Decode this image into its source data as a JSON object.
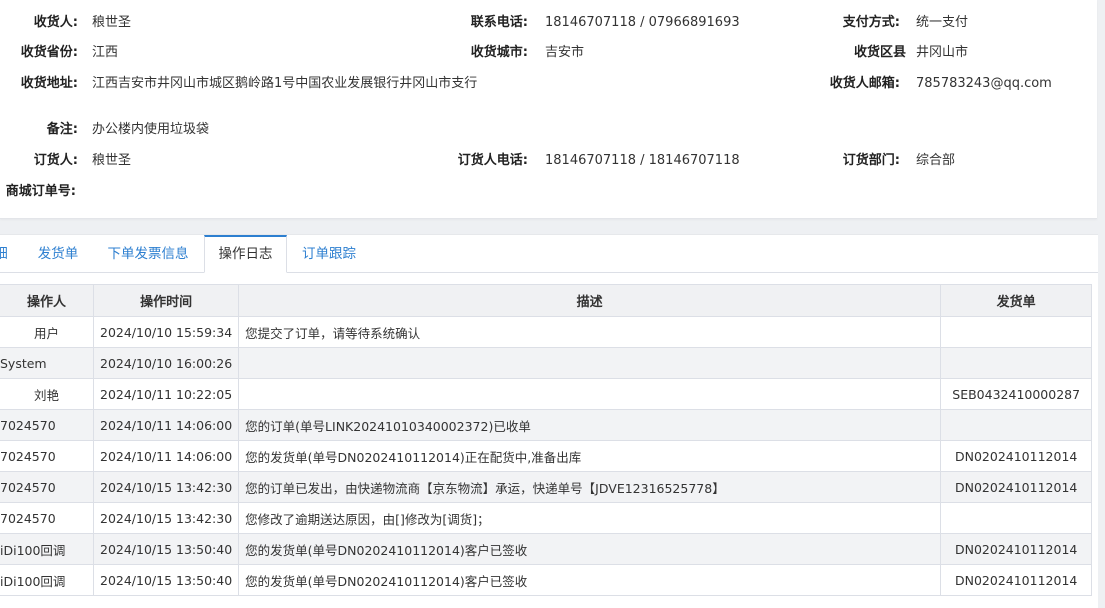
{
  "receiver": {
    "name_label": "收货人:",
    "name": "稂世圣",
    "phone_label": "联系电话:",
    "phone": "18146707118 / 07966891693",
    "pay_label": "支付方式:",
    "pay": "统一支付",
    "province_label": "收货省份:",
    "province": "江西",
    "city_label": "收货城市:",
    "city": "吉安市",
    "district_label": "收货区县",
    "district": "井冈山市",
    "address_label": "收货地址:",
    "address": "江西吉安市井冈山市城区鹅岭路1号中国农业发展银行井冈山市支行",
    "email_label": "收货人邮箱:",
    "email": "785783243@qq.com",
    "remark_label": "备注:",
    "remark": "办公楼内使用垃圾袋",
    "orderer_label": "订货人:",
    "orderer": "稂世圣",
    "orderer_phone_label": "订货人电话:",
    "orderer_phone": "18146707118 / 18146707118",
    "dept_label": "订货部门:",
    "dept": "综合部",
    "mall_order_label": "商城订单号:",
    "mall_order": ""
  },
  "tabs": [
    {
      "label": "细"
    },
    {
      "label": "发货单"
    },
    {
      "label": "下单发票信息"
    },
    {
      "label": "操作日志"
    },
    {
      "label": "订单跟踪"
    }
  ],
  "active_tab": "操作日志",
  "log_table": {
    "headers": [
      "操作人",
      "操作时间",
      "描述",
      "发货单"
    ],
    "rows": [
      {
        "op": "用户",
        "time": "2024/10/10 15:59:34",
        "desc": "您提交了订单，请等待系统确认",
        "ship": ""
      },
      {
        "op": "System",
        "time": "2024/10/10 16:00:26",
        "desc": "",
        "ship": ""
      },
      {
        "op": "刘艳",
        "time": "2024/10/11 10:22:05",
        "desc": "",
        "ship": "SEB0432410000287"
      },
      {
        "op": "7024570",
        "time": "2024/10/11 14:06:00",
        "desc": "您的订单(单号LINK20241010340002372)已收单",
        "ship": ""
      },
      {
        "op": "7024570",
        "time": "2024/10/11 14:06:00",
        "desc": "您的发货单(单号DN0202410112014)正在配货中,准备出库",
        "ship": "DN0202410112014"
      },
      {
        "op": "7024570",
        "time": "2024/10/15 13:42:30",
        "desc": "您的订单已发出，由快递物流商【京东物流】承运，快递单号【JDVE12316525778】",
        "ship": "DN0202410112014"
      },
      {
        "op": "7024570",
        "time": "2024/10/15 13:42:30",
        "desc": "您修改了逾期送达原因，由[]修改为[调货]；",
        "ship": ""
      },
      {
        "op": "iDi100回调",
        "time": "2024/10/15 13:50:40",
        "desc": "您的发货单(单号DN0202410112014)客户已签收",
        "ship": "DN0202410112014"
      },
      {
        "op": "iDi100回调",
        "time": "2024/10/15 13:50:40",
        "desc": "您的发货单(单号DN0202410112014)客户已签收",
        "ship": "DN0202410112014"
      }
    ]
  },
  "colors": {
    "accent": "#2d7fd0",
    "header_bg": "#f0f1f3",
    "alt_row_bg": "#f2f3f5"
  }
}
